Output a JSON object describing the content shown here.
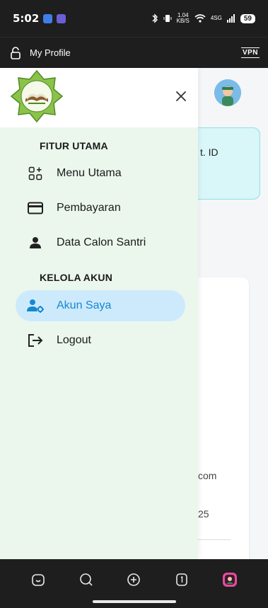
{
  "status_bar": {
    "time": "5:02",
    "network_speed_value": "1.04",
    "network_speed_unit": "KB/S",
    "network_type": "4SG",
    "battery": "59"
  },
  "browser": {
    "title": "My Profile",
    "vpn_label": "VPN"
  },
  "background_page": {
    "card_text": "t. ID",
    "email_fragment": "com",
    "number_fragment": "25"
  },
  "drawer": {
    "sections": [
      {
        "title": "FITUR UTAMA"
      },
      {
        "title": "KELOLA AKUN"
      }
    ],
    "items": [
      {
        "label": "Menu Utama",
        "icon": "apps-add-icon"
      },
      {
        "label": "Pembayaran",
        "icon": "credit-card-icon"
      },
      {
        "label": "Data Calon Santri",
        "icon": "person-icon"
      },
      {
        "label": "Akun Saya",
        "icon": "user-gear-icon",
        "active": true
      },
      {
        "label": "Logout",
        "icon": "logout-icon"
      }
    ]
  },
  "bottom_nav": {
    "icons": [
      "home-icon",
      "search-icon",
      "new-tab-icon",
      "tabs-icon",
      "profile-icon"
    ]
  },
  "colors": {
    "drawer_bg": "#ebf7ec",
    "active_item_bg": "#cdeafc",
    "active_item_text": "#1688d1",
    "teal_card": "#d9f6f8"
  }
}
